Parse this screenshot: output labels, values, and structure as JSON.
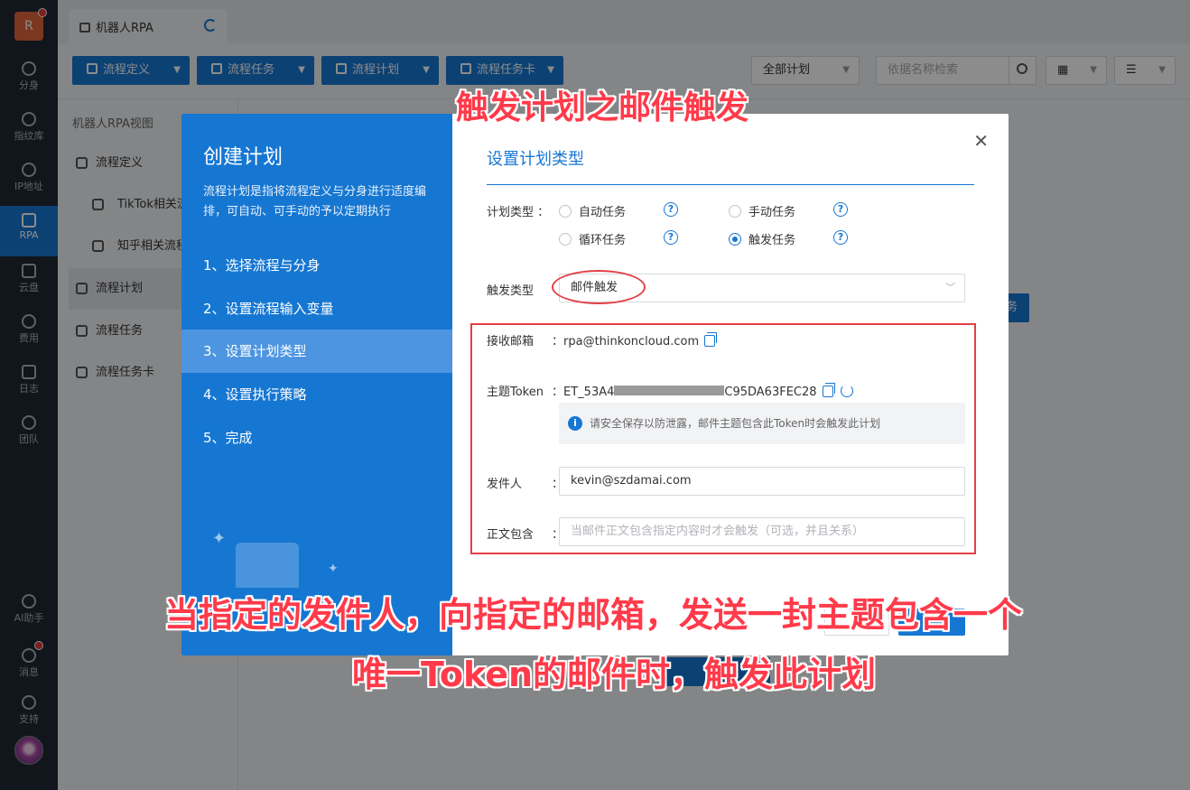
{
  "rail": {
    "logo": "R",
    "items": [
      {
        "label": "分身"
      },
      {
        "label": "指纹库"
      },
      {
        "label": "IP地址"
      },
      {
        "label": "RPA"
      },
      {
        "label": "云盘"
      },
      {
        "label": "费用"
      },
      {
        "label": "日志"
      },
      {
        "label": "团队"
      }
    ],
    "bottom": [
      {
        "label": "AI助手"
      },
      {
        "label": "消息"
      },
      {
        "label": "支持"
      }
    ]
  },
  "tab": {
    "title": "机器人RPA"
  },
  "toolbar": {
    "buttons": [
      "流程定义",
      "流程任务",
      "流程计划",
      "流程任务卡"
    ],
    "filter": "全部计划",
    "search_placeholder": "依据名称检索"
  },
  "subnav": {
    "title": "机器人RPA视图",
    "items": [
      "流程定义",
      "TikTok相关流程",
      "知乎相关流程",
      "流程计划",
      "流程任务",
      "流程任务卡"
    ]
  },
  "bg": {
    "button_fragment": "务"
  },
  "dialog": {
    "title": "创建计划",
    "description": "流程计划是指将流程定义与分身进行适度编排，可自动、可手动的予以定期执行",
    "steps": [
      "1、选择流程与分身",
      "2、设置流程输入变量",
      "3、设置计划类型",
      "4、设置执行策略",
      "5、完成"
    ],
    "section_title": "设置计划类型",
    "plan_type_label": "计划类型",
    "plan_types": [
      "自动任务",
      "手动任务",
      "循环任务",
      "触发任务"
    ],
    "plan_type_selected": "触发任务",
    "trigger_type_label": "触发类型",
    "trigger_type_value": "邮件触发",
    "mailbox_label": "接收邮箱",
    "mailbox_value": "rpa@thinkoncloud.com",
    "token_label": "主题Token",
    "token_prefix": "ET_53A4",
    "token_suffix": "C95DA63FEC28",
    "info_text": "请安全保存以防泄露，邮件主题包含此Token时会触发此计划",
    "sender_label": "发件人",
    "sender_value": "kevin@szdamai.com",
    "body_label": "正文包含",
    "body_placeholder": "当邮件正文包含指定内容时才会触发（可选，并且关系）"
  },
  "annotations": {
    "top": "触发计划之邮件触发",
    "bottom_line1": "当指定的发件人，向指定的邮箱，发送一封主题包含一个",
    "bottom_line2": "唯一Token的邮件时，触发此计划"
  },
  "colors": {
    "primary": "#1677d2",
    "annotation": "#ff3a4a",
    "rail": "#1f2733"
  }
}
